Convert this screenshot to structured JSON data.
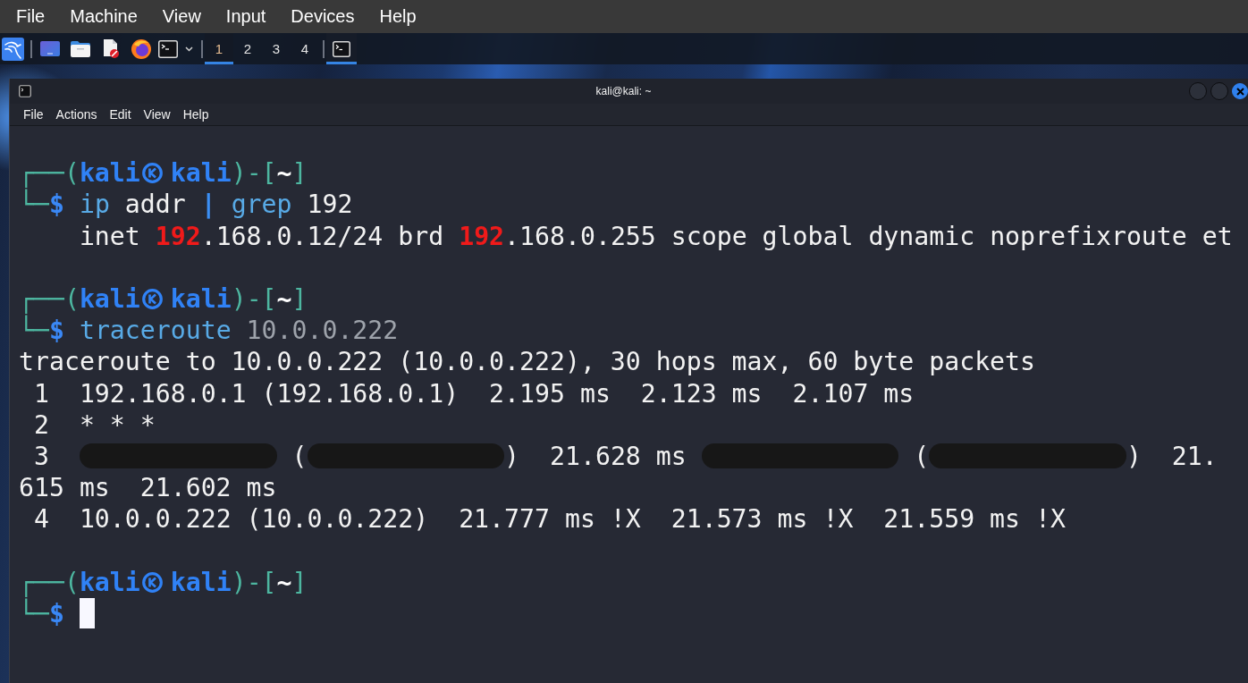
{
  "host_menu": [
    "File",
    "Machine",
    "View",
    "Input",
    "Devices",
    "Help"
  ],
  "taskbar": {
    "workspaces": [
      {
        "label": "1",
        "selected": true
      },
      {
        "label": "2",
        "selected": false
      },
      {
        "label": "3",
        "selected": false
      },
      {
        "label": "4",
        "selected": false
      }
    ],
    "windows": [
      {
        "selected": true
      }
    ]
  },
  "terminal": {
    "title": "kali@kali: ~",
    "menu": [
      "File",
      "Actions",
      "Edit",
      "View",
      "Help"
    ],
    "blocks": [
      {
        "prompt": {
          "corner_top": "┌──(",
          "user": "kali",
          "host": "kali",
          "separator": ")-[",
          "cwd": "~",
          "bracket_close": "]",
          "corner_bottom": "└─",
          "symbol": "$"
        },
        "command": [
          {
            "text": "ip",
            "kind": "program"
          },
          {
            "text": " addr ",
            "kind": "plain"
          },
          {
            "text": "|",
            "kind": "pipe"
          },
          {
            "text": " grep",
            "kind": "program"
          },
          {
            "text": " 192",
            "kind": "plain"
          }
        ],
        "output": [
          [
            {
              "text": "    inet ",
              "kind": "plain"
            },
            {
              "text": "192",
              "kind": "match"
            },
            {
              "text": ".168.0.12/24 brd ",
              "kind": "plain"
            },
            {
              "text": "192",
              "kind": "match"
            },
            {
              "text": ".168.0.255 scope global dynamic noprefixroute et",
              "kind": "plain"
            }
          ]
        ]
      },
      {
        "prompt": {
          "corner_top": "┌──(",
          "user": "kali",
          "host": "kali",
          "separator": ")-[",
          "cwd": "~",
          "bracket_close": "]",
          "corner_bottom": "└─",
          "symbol": "$"
        },
        "command": [
          {
            "text": "traceroute",
            "kind": "program"
          },
          {
            "text": " 10.0.0.222",
            "kind": "argument"
          }
        ],
        "output": [
          [
            {
              "text": "traceroute to 10.0.0.222 (10.0.0.222), 30 hops max, 60 byte packets",
              "kind": "plain"
            }
          ],
          [
            {
              "text": " 1  192.168.0.1 (192.168.0.1)  2.195 ms  2.123 ms  2.107 ms",
              "kind": "plain"
            }
          ],
          [
            {
              "text": " 2  * * *",
              "kind": "plain"
            }
          ],
          [
            {
              "text": " 3  ",
              "kind": "plain"
            },
            {
              "kind": "redacted"
            },
            {
              "text": " (",
              "kind": "plain"
            },
            {
              "kind": "redacted"
            },
            {
              "text": ")  21.628 ms ",
              "kind": "plain"
            },
            {
              "kind": "redacted"
            },
            {
              "text": " (",
              "kind": "plain"
            },
            {
              "kind": "redacted"
            },
            {
              "text": ")  21.",
              "kind": "plain"
            }
          ],
          [
            {
              "text": "615 ms  21.602 ms",
              "kind": "plain"
            }
          ],
          [
            {
              "text": " 4  10.0.0.222 (10.0.0.222)  21.777 ms !X  21.573 ms !X  21.559 ms !X",
              "kind": "plain"
            }
          ]
        ]
      },
      {
        "prompt": {
          "corner_top": "┌──(",
          "user": "kali",
          "host": "kali",
          "separator": ")-[",
          "cwd": "~",
          "bracket_close": "]",
          "corner_bottom": "└─",
          "symbol": "$"
        },
        "cursor": true
      }
    ]
  }
}
